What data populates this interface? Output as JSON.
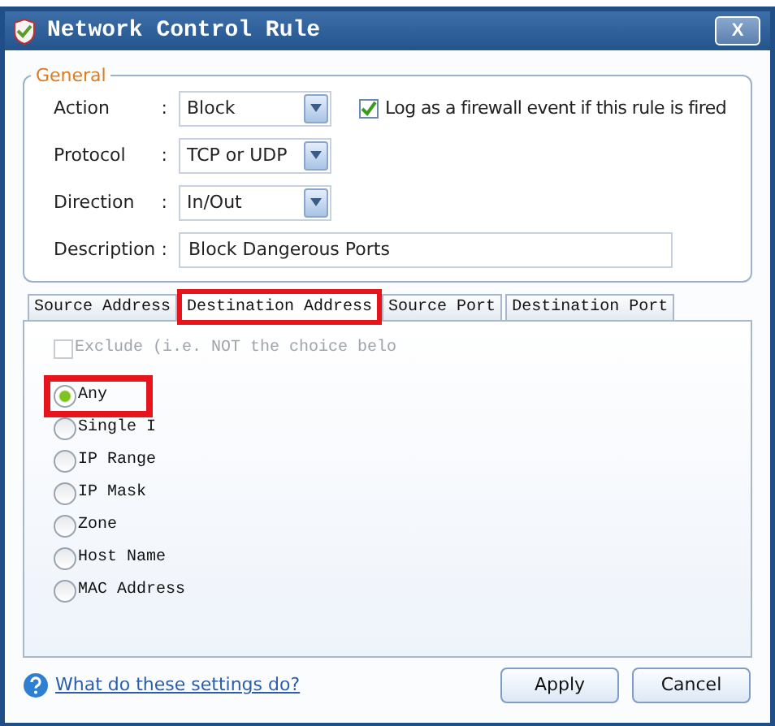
{
  "window": {
    "title": "Network Control Rule",
    "close": "X"
  },
  "general": {
    "legend": "General",
    "fields": [
      {
        "label": "Action",
        "separator": ":",
        "kind": "dropdown",
        "value": "Block"
      },
      {
        "label": "Protocol",
        "separator": ":",
        "kind": "dropdown",
        "value": "TCP or UDP"
      },
      {
        "label": "Direction",
        "separator": ":",
        "kind": "dropdown",
        "value": "In/Out"
      },
      {
        "label": "Description",
        "separator": ":",
        "kind": "text",
        "value": "Block Dangerous Ports"
      }
    ],
    "log_checkbox": {
      "label": "Log as a firewall event if this rule is fired",
      "checked": true
    }
  },
  "tabs": [
    {
      "label": "Source Address",
      "selected": false,
      "highlighted": false
    },
    {
      "label": "Destination Address",
      "selected": true,
      "highlighted": true
    },
    {
      "label": "Source Port",
      "selected": false,
      "highlighted": false
    },
    {
      "label": "Destination Port",
      "selected": false,
      "highlighted": false
    }
  ],
  "exclude": {
    "label": "Exclude (i.e. NOT the choice belo",
    "checked": false,
    "disabled": true
  },
  "options": [
    {
      "label": "Any",
      "selected": true,
      "highlighted": true
    },
    {
      "label": "Single I",
      "selected": false,
      "highlighted": false
    },
    {
      "label": "IP Range",
      "selected": false,
      "highlighted": false
    },
    {
      "label": "IP Mask",
      "selected": false,
      "highlighted": false
    },
    {
      "label": "Zone",
      "selected": false,
      "highlighted": false
    },
    {
      "label": "Host Name",
      "selected": false,
      "highlighted": false
    },
    {
      "label": "MAC Address",
      "selected": false,
      "highlighted": false
    }
  ],
  "help_link": "What do these settings do?",
  "buttons": [
    "Apply",
    "Cancel"
  ]
}
